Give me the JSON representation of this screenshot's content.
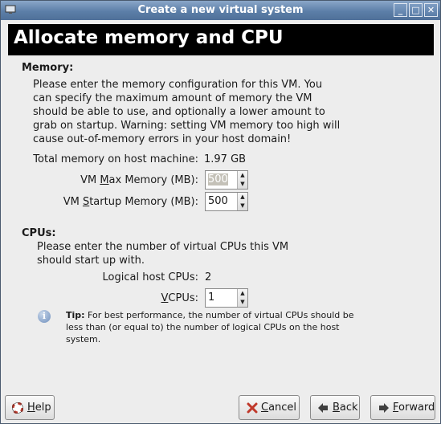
{
  "window": {
    "title": "Create a new virtual system"
  },
  "page": {
    "heading": "Allocate memory and CPU"
  },
  "memory": {
    "section_label": "Memory:",
    "intro": "Please enter the memory configuration for this VM. You\ncan specify the maximum amount of memory the VM\nshould be able to use, and optionally a lower amount to\ngrab on startup. Warning: setting VM memory too high will\ncause out-of-memory errors in your host domain!",
    "total_label": "Total memory on host machine:",
    "total_value": "1.97 GB",
    "max_label_pre": "VM ",
    "max_label_mn": "M",
    "max_label_post": "ax Memory (MB):",
    "max_value": "500",
    "startup_label_pre": "VM ",
    "startup_label_mn": "S",
    "startup_label_post": "tartup Memory (MB):",
    "startup_value": "500"
  },
  "cpus": {
    "section_label": "CPUs:",
    "intro": "Please enter the number of virtual CPUs this VM\nshould start up with.",
    "logical_label": "Logical host CPUs:",
    "logical_value": "2",
    "vcpus_label_mn": "V",
    "vcpus_label_post": "CPUs:",
    "vcpus_value": "1",
    "tip_bold": "Tip:",
    "tip_text": " For best performance, the number of virtual CPUs should be less than (or equal to) the number of logical CPUs on the host system."
  },
  "buttons": {
    "help_mn": "H",
    "help_post": "elp",
    "cancel_mn": "C",
    "cancel_post": "ancel",
    "back_mn": "B",
    "back_post": "ack",
    "forward_mn": "F",
    "forward_post": "orward"
  },
  "icons": {
    "app": "monitor-icon",
    "minimize": "minimize-icon",
    "maximize": "maximize-icon",
    "close": "close-icon",
    "info": "info-icon",
    "help": "lifebuoy-icon",
    "cancel": "red-x-icon",
    "back": "left-arrow-icon",
    "forward": "right-arrow-icon"
  },
  "colors": {
    "titlebar": "#5c7fa8",
    "header_bg": "#000000",
    "header_text": "#ffffff"
  }
}
